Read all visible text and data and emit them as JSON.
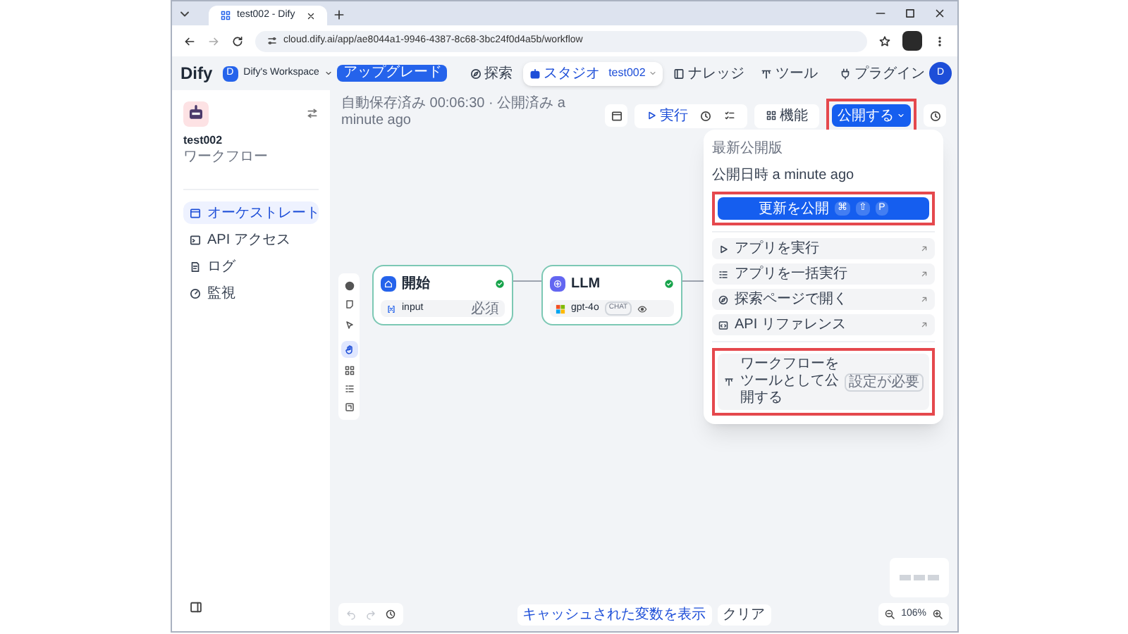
{
  "browser": {
    "tab_title": "test002 - Dify",
    "url": "cloud.dify.ai/app/ae8044a1-9946-4387-8c68-3bc24f0d4a5b/workflow"
  },
  "header": {
    "logo": "Dify",
    "workspace_avatar": "D",
    "workspace": "Dify's Workspace",
    "upgrade": "アップグレード",
    "plugins": "プラグイン",
    "avatar": "D",
    "nav": [
      {
        "kind": "explore",
        "label": "探索",
        "selected": false
      },
      {
        "kind": "studio",
        "label": "スタジオ",
        "selected": true,
        "current_app": "test002"
      },
      {
        "kind": "knowledge",
        "label": "ナレッジ",
        "selected": false
      },
      {
        "kind": "tools",
        "label": "ツール",
        "selected": false
      }
    ]
  },
  "sidebar": {
    "app_name": "test002",
    "app_type": "ワークフロー",
    "items": [
      {
        "kind": "orchestrate",
        "label": "オーケストレート",
        "selected": true
      },
      {
        "kind": "api",
        "label": "API アクセス",
        "selected": false
      },
      {
        "kind": "logs",
        "label": "ログ",
        "selected": false
      },
      {
        "kind": "monitor",
        "label": "監視",
        "selected": false
      }
    ]
  },
  "canvas": {
    "status": "自動保存済み 00:06:30 · 公開済み a minute ago",
    "tools": [
      {
        "kind": "pointer",
        "selected": false
      },
      {
        "kind": "hand",
        "selected": true
      }
    ],
    "nodes": [
      {
        "kind": "start",
        "title": "開始",
        "ok": true,
        "field": "input",
        "badge": "必須"
      },
      {
        "kind": "llm",
        "title": "LLM",
        "ok": true,
        "model": "gpt-4o",
        "mode": "CHAT"
      }
    ]
  },
  "toolbar": {
    "run": "実行",
    "features": "機能",
    "publish": {
      "label": "公開する",
      "highlighted": true
    }
  },
  "publish_menu": {
    "heading": "最新公開版",
    "published": "公開日時 a minute ago",
    "update": {
      "label": "更新を公開",
      "shortcut": [
        "⌘",
        "⇧",
        "P"
      ],
      "highlighted": true
    },
    "items": [
      {
        "kind": "run",
        "label": "アプリを実行"
      },
      {
        "kind": "batch",
        "label": "アプリを一括実行"
      },
      {
        "kind": "explore",
        "label": "探索ページで開く"
      },
      {
        "kind": "api",
        "label": "API リファレンス"
      }
    ],
    "tool_item": {
      "label": "ワークフローをツールとして公開する",
      "badge": "設定が必要",
      "highlighted": true
    }
  },
  "footer": {
    "cached_vars": "キャッシュされた変数を表示",
    "clear": "クリア",
    "zoom": "106%"
  }
}
